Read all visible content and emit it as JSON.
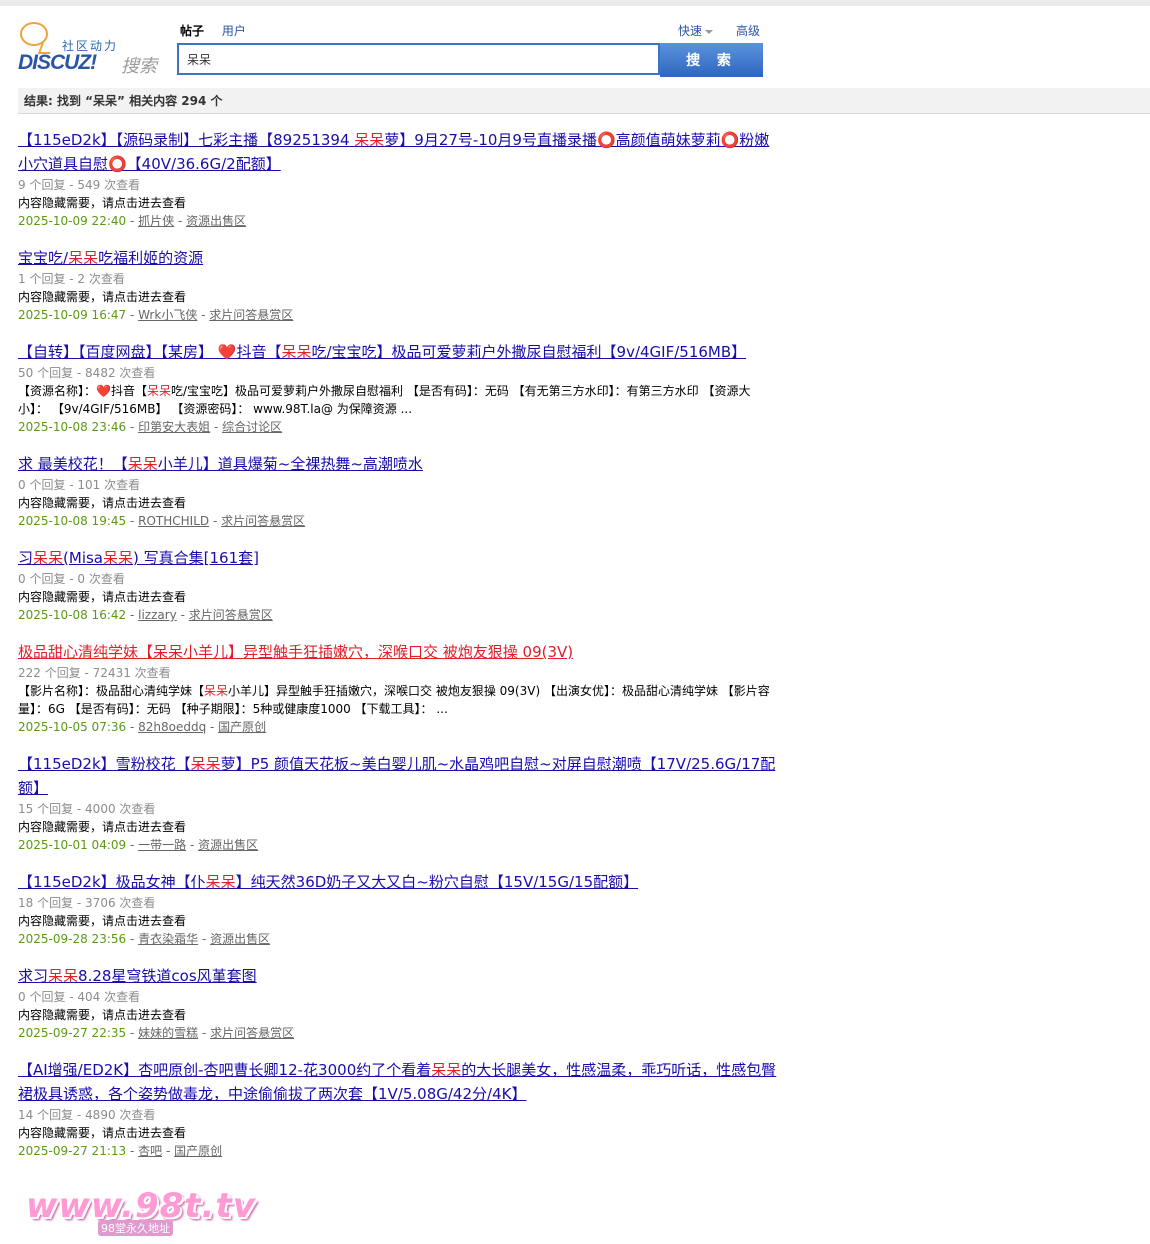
{
  "header": {
    "logo_slogan": "社区动力",
    "logo_brand": "DISCUZ!",
    "logo_sub": "搜索",
    "tab_posts": "帖子",
    "tab_users": "用户",
    "quick_label": "快速",
    "advanced_label": "高级",
    "search_value": "呆呆",
    "search_button": "搜 索"
  },
  "result_bar": "结果: 找到 “呆呆” 相关内容 294 个",
  "results": [
    {
      "title_parts": [
        "【115eD2k】【源码录制】七彩主播【89251394 ",
        "呆呆",
        "萝】9月27号-10月9号直播录播⭕高颜值萌妹萝莉⭕粉嫩小穴道具自慰⭕【40V/36.6G/2配额】"
      ],
      "meta": "9 个回复 - 549 次查看",
      "snippet_parts": [
        "内容隐藏需要，请点击进去查看"
      ],
      "date": "2025-10-09 22:40",
      "author": "抓片侠",
      "forum": "资源出售区"
    },
    {
      "title_parts": [
        "宝宝吃/",
        "呆呆",
        "吃福利姬的资源"
      ],
      "meta": "1 个回复 - 2 次查看",
      "snippet_parts": [
        "内容隐藏需要，请点击进去查看"
      ],
      "date": "2025-10-09 16:47",
      "author": "Wrk小飞侠",
      "forum": "求片问答悬赏区"
    },
    {
      "title_parts": [
        "【自转】【百度网盘】【某房】 ❤️抖音【",
        "呆呆",
        "吃/宝宝吃】极品可爱萝莉户外撒尿自慰福利【9v/4GIF/516MB】"
      ],
      "meta": "50 个回复 - 8482 次查看",
      "snippet_parts": [
        "【资源名称】：❤️抖音【",
        "呆呆",
        "吃/宝宝吃】极品可爱萝莉户外撒尿自慰福利 【是否有码】：无码 【有无第三方水印】：有第三方水印 【资源大小】： 【9v/4GIF/516MB】 【资源密码】： www.98T.la@ 为保障资源 ..."
      ],
      "date": "2025-10-08 23:46",
      "author": "印第安大表姐",
      "forum": "综合讨论区"
    },
    {
      "title_parts": [
        "求 最美校花！【",
        "呆呆",
        "小羊儿】道具爆菊~全裸热舞~高潮喷水"
      ],
      "meta": "0 个回复 - 101 次查看",
      "snippet_parts": [
        "内容隐藏需要，请点击进去查看"
      ],
      "date": "2025-10-08 19:45",
      "author": "ROTHCHILD",
      "forum": "求片问答悬赏区"
    },
    {
      "title_parts": [
        "习",
        "呆呆",
        "(Misa",
        "呆呆",
        ") 写真合集[161套]"
      ],
      "meta": "0 个回复 - 0 次查看",
      "snippet_parts": [
        "内容隐藏需要，请点击进去查看"
      ],
      "date": "2025-10-08 16:42",
      "author": "lizzary",
      "forum": "求片问答悬赏区"
    },
    {
      "title_parts": [
        "极品甜心清纯学妹【呆呆小羊儿】异型触手狂插嫩穴，深喉口交 被炮友狠操 09(3V)"
      ],
      "title_red": true,
      "meta": "222 个回复 - 72431 次查看",
      "snippet_parts": [
        "【影片名称】：极品甜心清纯学妹【",
        "呆呆",
        "小羊儿】异型触手狂插嫩穴，深喉口交 被炮友狠操 09(3V) 【出演女优】：极品甜心清纯学妹 【影片容量】：6G 【是否有码】：无码 【种子期限】：5种或健康度1000 【下载工具】： ..."
      ],
      "date": "2025-10-05 07:36",
      "author": "82h8oeddq",
      "forum": "国产原创"
    },
    {
      "title_parts": [
        "【115eD2k】雪粉校花【",
        "呆呆",
        "萝】P5 颜值天花板~美白婴儿肌~水晶鸡吧自慰~对屏自慰潮喷【17V/25.6G/17配额】"
      ],
      "meta": "15 个回复 - 4000 次查看",
      "snippet_parts": [
        "内容隐藏需要，请点击进去查看"
      ],
      "date": "2025-10-01 04:09",
      "author": "一带一路",
      "forum": "资源出售区"
    },
    {
      "title_parts": [
        "【115eD2k】极品女神【仆",
        "呆呆",
        "】纯天然36D奶子又大又白~粉穴自慰【15V/15G/15配额】"
      ],
      "meta": "18 个回复 - 3706 次查看",
      "snippet_parts": [
        "内容隐藏需要，请点击进去查看"
      ],
      "date": "2025-09-28 23:56",
      "author": "青衣染霜华",
      "forum": "资源出售区"
    },
    {
      "title_parts": [
        "求习",
        "呆呆",
        "8.28星穹铁道cos风堇套图"
      ],
      "meta": "0 个回复 - 404 次查看",
      "snippet_parts": [
        "内容隐藏需要，请点击进去查看"
      ],
      "date": "2025-09-27 22:35",
      "author": "妹妹的雪糕",
      "forum": "求片问答悬赏区"
    },
    {
      "title_parts": [
        "【AI增强/ED2K】杏吧原创-杏吧曹长卿12-花3000约了个看着",
        "呆呆",
        "的大长腿美女，性感温柔，乖巧听话，性感包臀裙极具诱惑，各个姿势做毒龙，中途偷偷拔了两次套【1V/5.08G/42分/4K】"
      ],
      "meta": "14 个回复 - 4890 次查看",
      "snippet_parts": [
        "内容隐藏需要，请点击进去查看"
      ],
      "date": "2025-09-27 21:13",
      "author": "杏吧",
      "forum": "国产原创"
    }
  ],
  "watermark": {
    "big": "www.98t.tv",
    "small": "98堂永久地址"
  }
}
